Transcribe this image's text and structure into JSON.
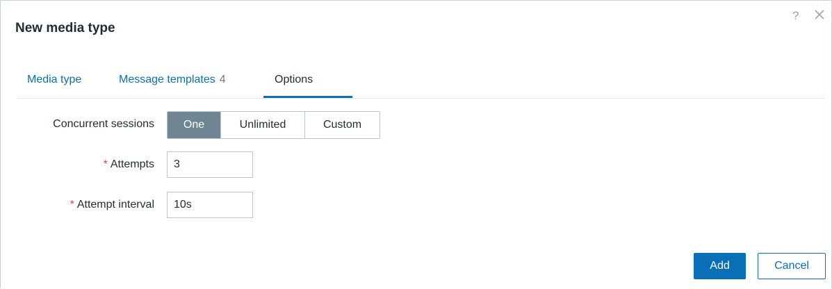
{
  "dialog": {
    "title": "New media type",
    "help_icon": "?",
    "close_icon": "close-icon"
  },
  "tabs": [
    {
      "label": "Media type",
      "count": "",
      "active": false
    },
    {
      "label": "Message templates",
      "count": "4",
      "active": false
    },
    {
      "label": "Options",
      "count": "",
      "active": true
    }
  ],
  "form": {
    "concurrent_sessions": {
      "label": "Concurrent sessions",
      "options": [
        "One",
        "Unlimited",
        "Custom"
      ],
      "selected": "One"
    },
    "attempts": {
      "required_mark": "*",
      "label": "Attempts",
      "value": "3"
    },
    "attempt_interval": {
      "required_mark": "*",
      "label": "Attempt interval",
      "value": "10s"
    }
  },
  "footer": {
    "add_label": "Add",
    "cancel_label": "Cancel"
  },
  "colors": {
    "accent": "#0b6fb7",
    "selected_segment": "#6f8591",
    "required": "#e0443b"
  }
}
